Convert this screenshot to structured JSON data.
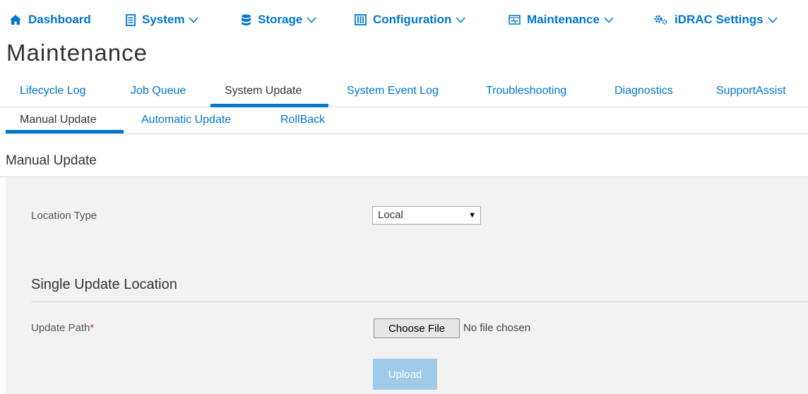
{
  "nav": {
    "dashboard": "Dashboard",
    "system": "System",
    "storage": "Storage",
    "configuration": "Configuration",
    "maintenance": "Maintenance",
    "idrac_settings": "iDRAC Settings"
  },
  "page_title": "Maintenance",
  "primary_tabs": [
    {
      "label": "Lifecycle Log"
    },
    {
      "label": "Job Queue"
    },
    {
      "label": "System Update",
      "active": true
    },
    {
      "label": "System Event Log"
    },
    {
      "label": "Troubleshooting"
    },
    {
      "label": "Diagnostics"
    },
    {
      "label": "SupportAssist"
    }
  ],
  "secondary_tabs": [
    {
      "label": "Manual Update",
      "active": true
    },
    {
      "label": "Automatic Update"
    },
    {
      "label": "RollBack"
    }
  ],
  "section_title": "Manual Update",
  "form": {
    "location_type_label": "Location Type",
    "location_type_value": "Local",
    "single_update_title": "Single Update Location",
    "update_path_label": "Update Path",
    "required_mark": "*",
    "choose_file_label": "Choose File",
    "file_status": "No file chosen",
    "upload_label": "Upload"
  },
  "colors": {
    "accent": "#0076ce",
    "panel_bg": "#f2f2f2",
    "upload_disabled": "#9fcbe8",
    "required": "#c7382c"
  }
}
